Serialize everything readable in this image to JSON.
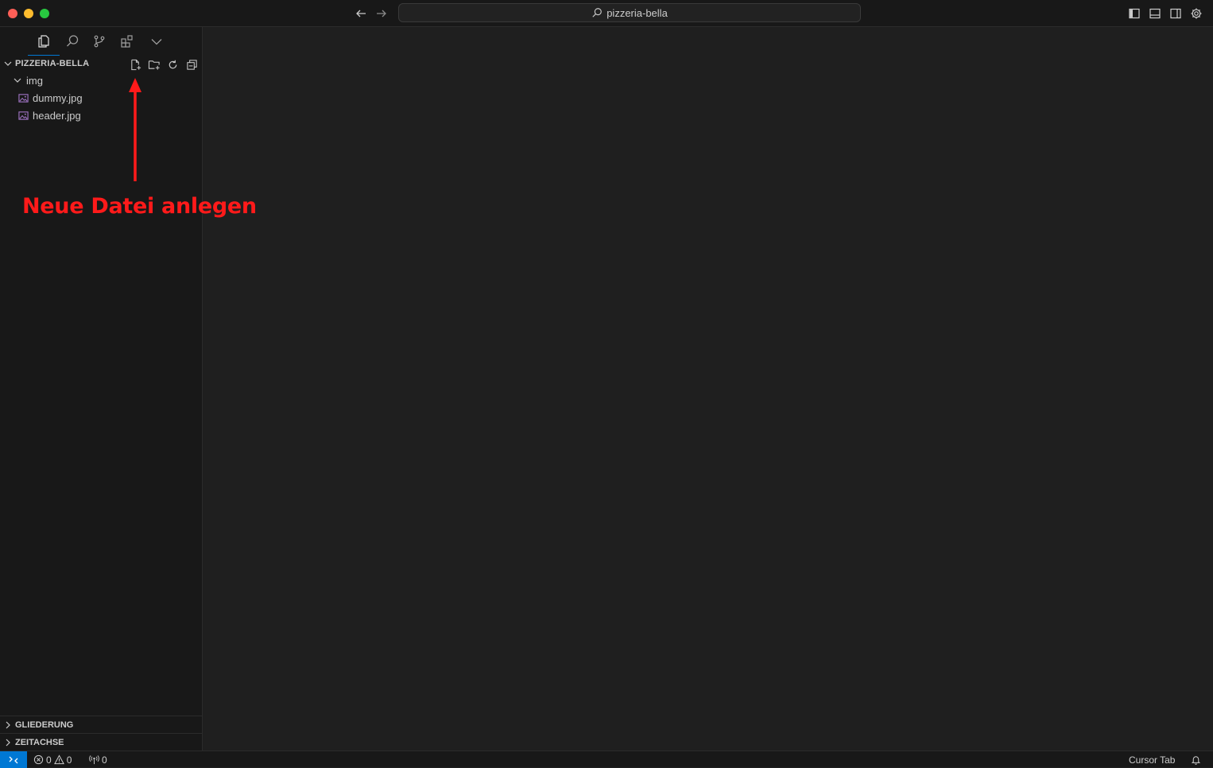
{
  "titlebar": {
    "search_text": "pizzeria-bella"
  },
  "sidebar": {
    "project_name": "PIZZERIA-BELLA",
    "tree": [
      {
        "label": "img",
        "type": "folder"
      },
      {
        "label": "dummy.jpg",
        "type": "image-file"
      },
      {
        "label": "header.jpg",
        "type": "image-file"
      }
    ],
    "sections": [
      {
        "label": "GLIEDERUNG"
      },
      {
        "label": "ZEITACHSE"
      }
    ]
  },
  "annotation": {
    "text": "Neue Datei anlegen",
    "color": "#ff1a1a"
  },
  "statusbar": {
    "errors": "0",
    "warnings": "0",
    "ports": "0",
    "cursor_tab": "Cursor Tab"
  },
  "colors": {
    "accent": "#0078d4",
    "background": "#1f1f1f",
    "sidebar": "#181818"
  }
}
